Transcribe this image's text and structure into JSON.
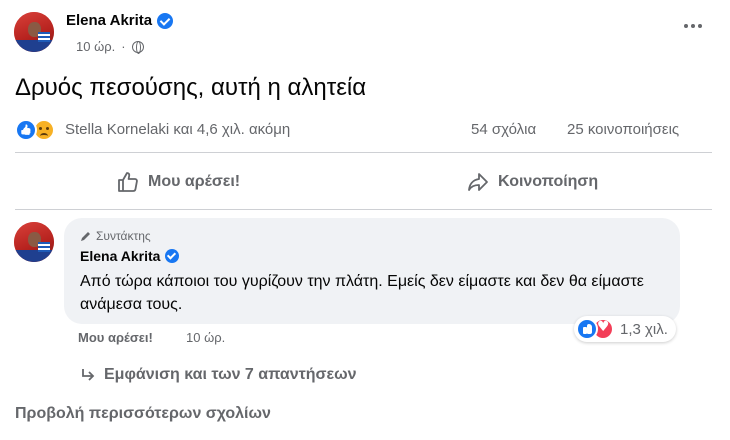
{
  "post": {
    "author": "Elena Akrita",
    "time": "10 ώρ.",
    "text": "Δρυός πεσούσης, αυτή η αλητεία",
    "reactions_text": "Stella Kornelaki και 4,6 χιλ. ακόμη",
    "comments_count": "54 σχόλια",
    "shares_count": "25 κοινοποιήσεις",
    "reaction_icons": [
      "like-icon",
      "sad-icon"
    ]
  },
  "actions": {
    "like_label": "Μου αρέσει!",
    "share_label": "Κοινοποίηση"
  },
  "comment": {
    "badge": "Συντάκτης",
    "author": "Elena Akrita",
    "text": "Από τώρα κάποιοι του γυρίζουν την πλάτη. Εμείς δεν είμαστε και δεν θα είμαστε ανάμεσα τους.",
    "like_label": "Μου αρέσει!",
    "time": "10 ώρ.",
    "reactions_count": "1,3 χιλ.",
    "reaction_icons": [
      "like-icon",
      "love-icon"
    ]
  },
  "replies": {
    "label": "Εμφάνιση και των 7 απαντήσεων"
  },
  "more_comments": {
    "label": "Προβολή περισσότερων σχολίων"
  },
  "colors": {
    "brand_blue": "#1877f2",
    "secondary_text": "#65676b",
    "bubble_bg": "#f0f2f5",
    "love_red": "#f33e58",
    "sad_yellow": "#f7b125"
  }
}
